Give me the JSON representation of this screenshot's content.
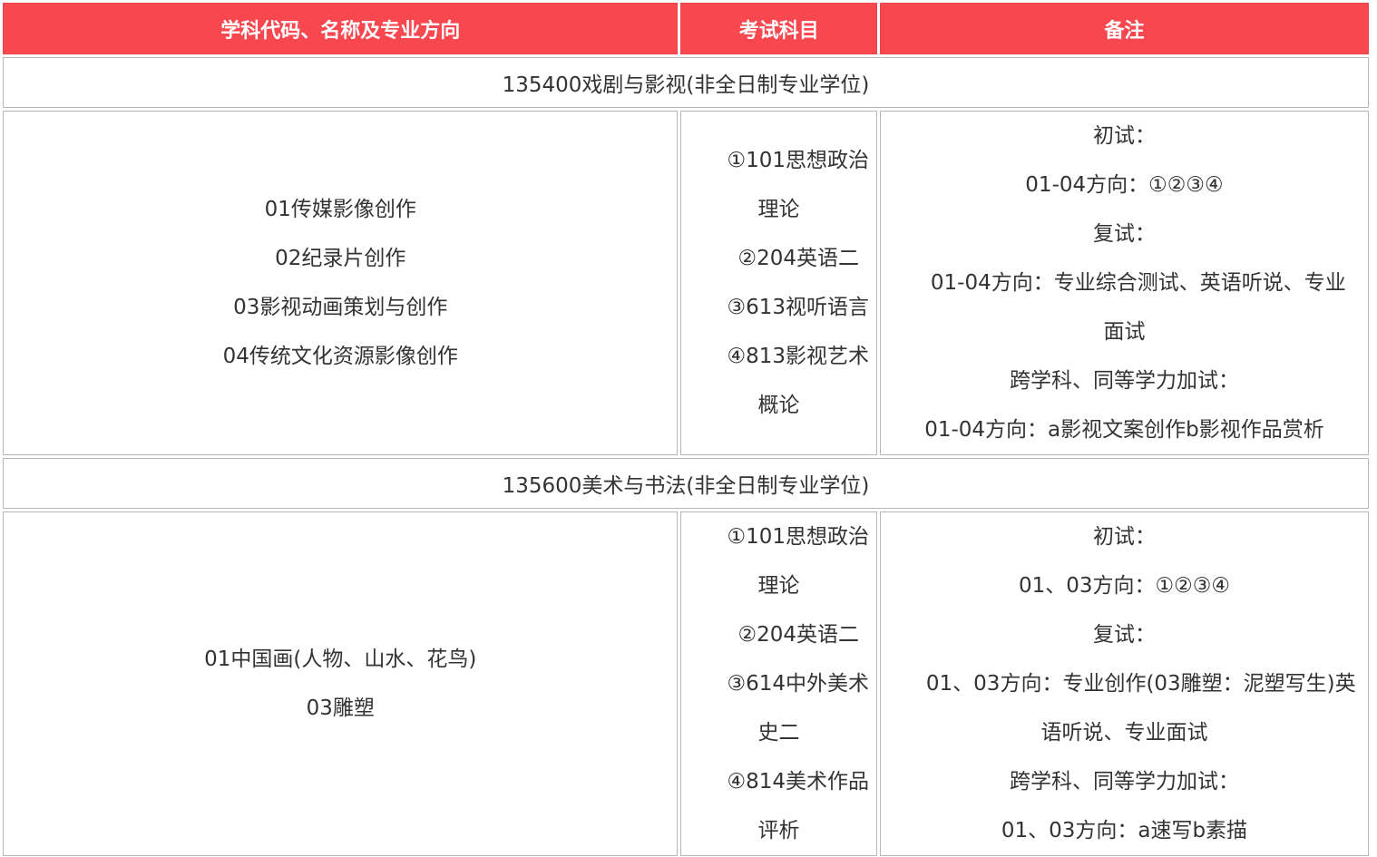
{
  "header": {
    "col1": "学科代码、名称及专业方向",
    "col2": "考试科目",
    "col3": "备注"
  },
  "sections": [
    {
      "title": "135400戏剧与影视(非全日制专业学位)",
      "directions": [
        "01传媒影像创作",
        "02纪录片创作",
        "03影视动画策划与创作",
        "04传统文化资源影像创作"
      ],
      "subjects": [
        "①101思想政治",
        "理论",
        "②204英语二",
        "③613视听语言",
        "④813影视艺术",
        "概论"
      ],
      "notes": [
        "初试：",
        "01-04方向：①②③④",
        "复试：",
        "01-04方向：专业综合测试、英语听说、专业",
        "面试",
        "跨学科、同等学力加试：",
        "01-04方向：a影视文案创作b影视作品赏析"
      ]
    },
    {
      "title": "135600美术与书法(非全日制专业学位)",
      "directions": [
        "01中国画(人物、山水、花鸟)",
        "03雕塑"
      ],
      "subjects": [
        "①101思想政治",
        "理论",
        "②204英语二",
        "③614中外美术",
        "史二",
        "④814美术作品",
        "评析"
      ],
      "notes": [
        "初试：",
        "01、03方向：①②③④",
        "复试：",
        "01、03方向：专业创作(03雕塑：泥塑写生)英",
        "语听说、专业面试",
        "跨学科、同等学力加试：",
        "01、03方向：a速写b素描"
      ]
    }
  ]
}
